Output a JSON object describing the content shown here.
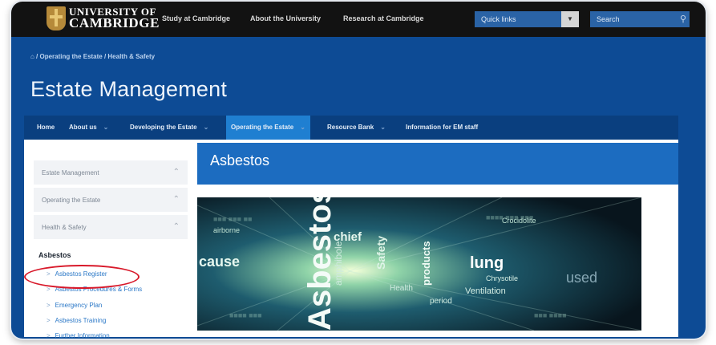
{
  "header": {
    "university_line1": "UNIVERSITY OF",
    "university_line2": "CAMBRIDGE",
    "nav": [
      "Study at Cambridge",
      "About the University",
      "Research at Cambridge"
    ],
    "quick_links": "Quick links",
    "search_placeholder": "Search"
  },
  "breadcrumb": "⌂ / Operating the Estate / Health & Safety",
  "site_title": "Estate Management",
  "main_nav": [
    {
      "label": "Home"
    },
    {
      "label": "About us"
    },
    {
      "label": "Developing the Estate"
    },
    {
      "label": "Operating the Estate",
      "active": true
    },
    {
      "label": "Resource Bank"
    },
    {
      "label": "Information for EM staff"
    }
  ],
  "sidebar": {
    "sections": [
      "Estate Management",
      "Operating the Estate",
      "Health & Safety"
    ],
    "heading": "Asbestos",
    "links": [
      "Asbestos Register",
      "Asbestos Procedures & Forms",
      "Emergency Plan",
      "Asbestos Training",
      "Further Information"
    ]
  },
  "page_heading": "Asbestos",
  "hero": {
    "big_word": "Asbestos",
    "words": [
      "chief",
      "lung",
      "cause",
      "Safety",
      "products",
      "amphibole",
      "Crocidolite",
      "Chrysotile",
      "used",
      "Ventilation",
      "Health",
      "period",
      "airborne"
    ]
  },
  "colors": {
    "brand_blue": "#0d4b95",
    "active_tab": "#1f7fd1",
    "link": "#2b78c7",
    "highlight_ellipse": "#d8192a"
  }
}
